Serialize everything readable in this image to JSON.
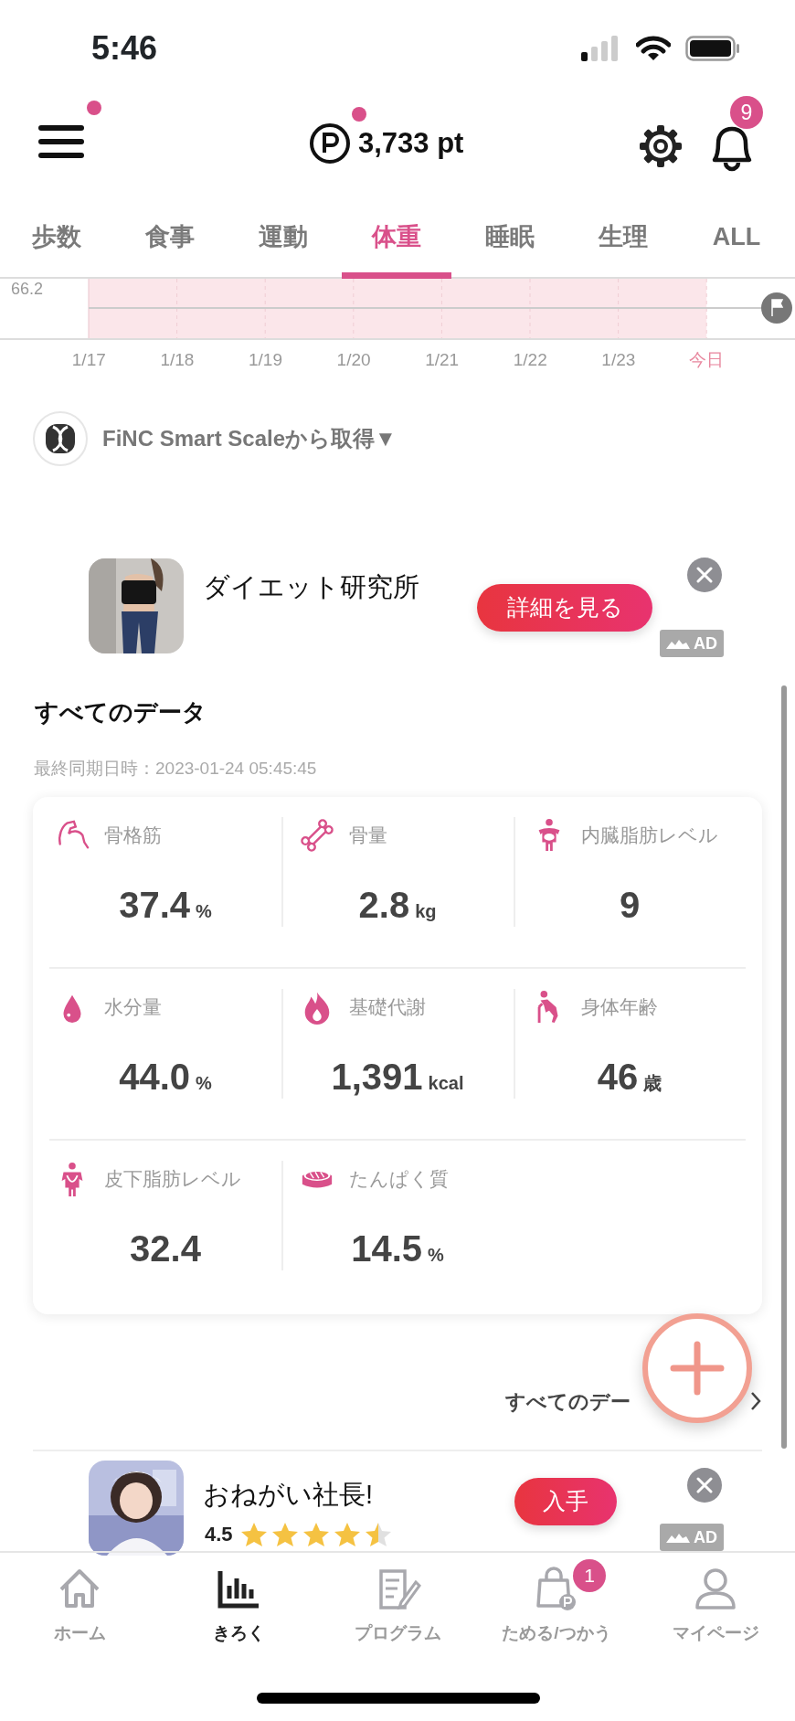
{
  "status_bar": {
    "time": "5:46"
  },
  "header": {
    "menu_dot": true,
    "points": "3,733 pt",
    "points_dot": true,
    "notifications": "9"
  },
  "tabs": [
    {
      "label": "歩数",
      "selected": false
    },
    {
      "label": "食事",
      "selected": false
    },
    {
      "label": "運動",
      "selected": false
    },
    {
      "label": "体重",
      "selected": true
    },
    {
      "label": "睡眠",
      "selected": false
    },
    {
      "label": "生理",
      "selected": false
    },
    {
      "label": "ALL",
      "selected": false
    }
  ],
  "chart": {
    "y_label": "66.2",
    "dates": [
      {
        "label": "1/17",
        "today": false
      },
      {
        "label": "1/18",
        "today": false
      },
      {
        "label": "1/19",
        "today": false
      },
      {
        "label": "1/20",
        "today": false
      },
      {
        "label": "1/21",
        "today": false
      },
      {
        "label": "1/22",
        "today": false
      },
      {
        "label": "1/23",
        "today": false
      },
      {
        "label": "今日",
        "today": true
      }
    ]
  },
  "source": {
    "label": "FiNC Smart Scaleから取得▼"
  },
  "ad_top": {
    "title": "ダイエット研究所",
    "button": "詳細を見る",
    "badge": "AD"
  },
  "all_data": {
    "title": "すべてのデータ",
    "synced": "最終同期日時：2023-01-24 05:45:45",
    "metrics": [
      {
        "kind": "muscle",
        "label": "骨格筋",
        "value": "37.4",
        "unit": "%"
      },
      {
        "kind": "bone",
        "label": "骨量",
        "value": "2.8",
        "unit": "kg"
      },
      {
        "kind": "visceral",
        "label": "内臓脂肪レベル",
        "value": "9"
      },
      {
        "kind": "water",
        "label": "水分量",
        "value": "44.0",
        "unit": "%"
      },
      {
        "kind": "flame",
        "label": "基礎代謝",
        "value": "1,391",
        "unit": "kcal"
      },
      {
        "kind": "age",
        "label": "身体年齢",
        "value": "46",
        "unit": "歳"
      },
      {
        "kind": "subcutaneous",
        "label": "皮下脂肪レベル",
        "value": "32.4"
      },
      {
        "kind": "meat",
        "label": "たんぱく質",
        "value": "14.5",
        "unit": "%"
      }
    ],
    "link": "すべてのデー"
  },
  "ad_bottom": {
    "title": "おねがい社長!",
    "rating": "4.5",
    "stars": 4.5,
    "button": "入手",
    "badge": "AD"
  },
  "bottom_nav": [
    {
      "kind": "home",
      "label": "ホーム",
      "selected": false
    },
    {
      "kind": "chart",
      "label": "きろく",
      "selected": true
    },
    {
      "kind": "program",
      "label": "プログラム",
      "selected": false
    },
    {
      "kind": "points",
      "label": "ためる/つかう",
      "selected": false,
      "badge": "1"
    },
    {
      "kind": "user",
      "label": "マイページ",
      "selected": false
    }
  ]
}
